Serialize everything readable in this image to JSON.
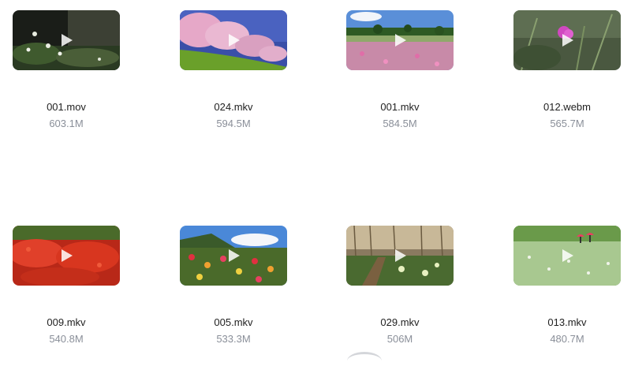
{
  "videos": [
    {
      "name": "001.mov",
      "size": "603.1M"
    },
    {
      "name": "024.mkv",
      "size": "594.5M"
    },
    {
      "name": "001.mkv",
      "size": "584.5M"
    },
    {
      "name": "012.webm",
      "size": "565.7M"
    },
    {
      "name": "009.mkv",
      "size": "540.8M"
    },
    {
      "name": "005.mkv",
      "size": "533.3M"
    },
    {
      "name": "029.mkv",
      "size": "506M"
    },
    {
      "name": "013.mkv",
      "size": "480.7M"
    }
  ],
  "colors": {
    "filename": "#222222",
    "filesize": "#8a8f99",
    "background": "#ffffff"
  },
  "icons": {
    "play": "play-icon",
    "loading": "loading-spinner"
  }
}
